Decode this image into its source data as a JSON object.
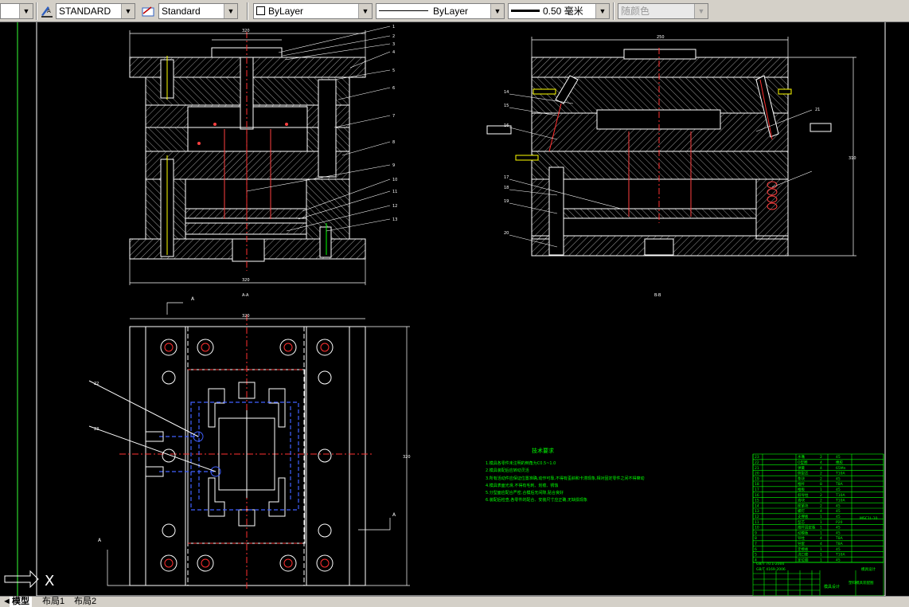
{
  "toolbar": {
    "text_style": "STANDARD",
    "dim_style": "Standard",
    "layer": "ByLayer",
    "linetype": "ByLayer",
    "lineweight": "0.50 毫米",
    "color": "随颜色",
    "icons": {
      "text_style": "text-style-icon",
      "dim_style": "dimension-style-icon"
    }
  },
  "drawing": {
    "view_aa": "A-A",
    "view_bb": "B-B",
    "title_tech": "技术要求",
    "tech_lines": [
      "1.模具各零件未注明的倒角为C0.5~1.0",
      "2.模具装配后应转动灵活",
      "3.所有活动件应保证位置准确,动作可靠,不得有歪斜和卡滞现象,相对固定零件之间不得窜动",
      "4.模具表面光滑,不得有毛刺、划痕、锈蚀",
      "5.分型面应配合严密,合模后无间隙,贴合良好",
      "6.装配后检查,各零件的配合、安装尺寸应正确,无缺损现象"
    ],
    "dims": {
      "a_top": "320",
      "a_bottom": "320",
      "b_top": "250",
      "plan_top": "320",
      "plan_side": "320",
      "b_side": "310"
    },
    "leader_numbers_a": [
      "1",
      "2",
      "3",
      "4",
      "5",
      "6",
      "7",
      "8",
      "9",
      "10",
      "11",
      "12",
      "13"
    ],
    "leader_numbers_b": [
      "14",
      "15",
      "16",
      "17",
      "18",
      "19",
      "20",
      "21"
    ],
    "leader_numbers_plan": [
      "22",
      "23"
    ],
    "section_mark": "A",
    "title_block": {
      "rows": [
        [
          "23",
          "水嘴",
          "2",
          "45"
        ],
        [
          "22",
          "O型圈",
          "4",
          "橡胶"
        ],
        [
          "21",
          "弹簧",
          "4",
          "65Mn"
        ],
        [
          "20",
          "侧型芯",
          "2",
          "T10A"
        ],
        [
          "19",
          "垫块",
          "2",
          "45"
        ],
        [
          "18",
          "推杆",
          "8",
          "T8A"
        ],
        [
          "17",
          "推板",
          "1",
          "45"
        ],
        [
          "16",
          "斜导柱",
          "2",
          "T10A"
        ],
        [
          "15",
          "滑块",
          "2",
          "T10A"
        ],
        [
          "14",
          "楔紧块",
          "2",
          "45"
        ],
        [
          "13",
          "螺钉",
          "4",
          "45"
        ],
        [
          "12",
          "支撑板",
          "1",
          "45"
        ],
        [
          "11",
          "型芯",
          "1",
          "P20"
        ],
        [
          "10",
          "推杆固定板",
          "1",
          "45"
        ],
        [
          "9",
          "动模板",
          "1",
          "45"
        ],
        [
          "8",
          "导柱",
          "4",
          "T8A"
        ],
        [
          "7",
          "导套",
          "4",
          "T8A"
        ],
        [
          "6",
          "定模板",
          "1",
          "45"
        ],
        [
          "5",
          "浇口套",
          "1",
          "T10A"
        ],
        [
          "4",
          "定位圈",
          "1",
          "45"
        ]
      ],
      "company": "模具设计",
      "drawing_name": "塑料模具装配图",
      "note_1": "GB/T 70.1-2000",
      "note_2": "GB/T 4169-2006",
      "spec": "MSC1L-10"
    }
  },
  "ucs": {
    "x_label": "X"
  },
  "tabs": [
    "模型",
    "布局1",
    "布局2"
  ]
}
